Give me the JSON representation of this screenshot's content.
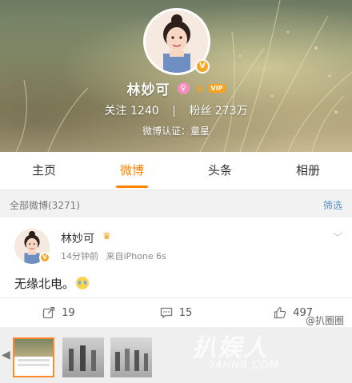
{
  "profile": {
    "name": "林妙可",
    "gender_icon": "female-icon",
    "vip_label": "VIP",
    "following_label": "关注",
    "following_count": "1240",
    "followers_label": "粉丝",
    "followers_count": "273万",
    "verification": "微博认证：童星"
  },
  "tabs": [
    "主页",
    "微博",
    "头条",
    "相册"
  ],
  "active_tab": "微博",
  "filter": {
    "all_label": "全部微博(3271)",
    "filter_label": "筛选"
  },
  "post": {
    "author": "林妙可",
    "time": "14分钟前",
    "source": "来自iPhone 6s",
    "text": "无缘北电。",
    "reposts": "19",
    "comments": "15",
    "likes": "497"
  },
  "watermark": {
    "handle": "@扒圈圈",
    "site_big": "扒娱人",
    "site_small": "94HNR.COM"
  },
  "colors": {
    "accent": "#ff8200",
    "link": "#5a8ec3",
    "verified_badge": "#f6a623"
  }
}
